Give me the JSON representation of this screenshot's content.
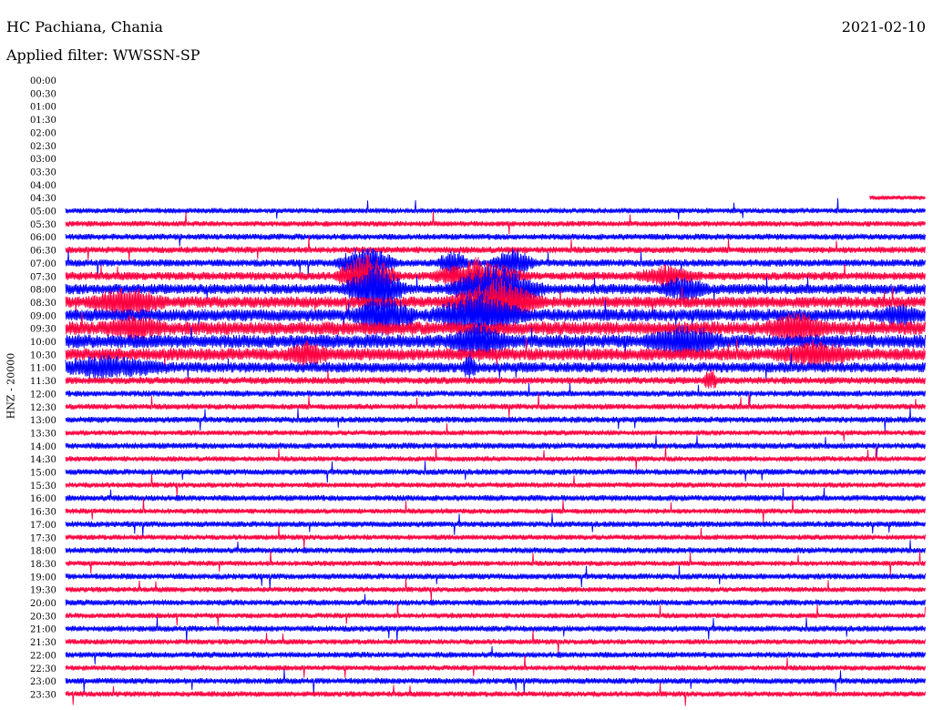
{
  "header": {
    "station": "HC Pachiana, Chania",
    "date": "2021-02-10",
    "filter_label": "Applied filter: WWSSN-SP"
  },
  "chart_data": {
    "type": "line",
    "title": "HC Pachiana, Chania",
    "ylabel": "HNZ - 20000",
    "time_labels": [
      "00:00",
      "00:30",
      "01:00",
      "01:30",
      "02:00",
      "02:30",
      "03:00",
      "03:30",
      "04:00",
      "04:30",
      "05:00",
      "05:30",
      "06:00",
      "06:30",
      "07:00",
      "07:30",
      "08:00",
      "08:30",
      "09:00",
      "09:30",
      "10:00",
      "10:30",
      "11:00",
      "11:30",
      "12:00",
      "12:30",
      "13:00",
      "13:30",
      "14:00",
      "14:30",
      "15:00",
      "15:30",
      "16:00",
      "16:30",
      "17:00",
      "17:30",
      "18:00",
      "18:30",
      "19:00",
      "19:30",
      "20:00",
      "20:30",
      "21:00",
      "21:30",
      "22:00",
      "22:30",
      "23:00",
      "23:30"
    ],
    "colors": {
      "even_rows": "#0000ff",
      "odd_rows": "#ff0040"
    },
    "rows": [
      {
        "start": 0,
        "end": 0,
        "amp": 0
      },
      {
        "start": 0,
        "end": 0,
        "amp": 0
      },
      {
        "start": 0,
        "end": 0,
        "amp": 0
      },
      {
        "start": 0,
        "end": 0,
        "amp": 0
      },
      {
        "start": 0,
        "end": 0,
        "amp": 0
      },
      {
        "start": 0,
        "end": 0,
        "amp": 0
      },
      {
        "start": 0,
        "end": 0,
        "amp": 0
      },
      {
        "start": 0,
        "end": 0,
        "amp": 0
      },
      {
        "start": 0,
        "end": 0,
        "amp": 0
      },
      {
        "start": 0.935,
        "end": 1,
        "amp": 2.2
      },
      {
        "start": 0,
        "end": 1,
        "amp": 2.6
      },
      {
        "start": 0,
        "end": 1,
        "amp": 2.7
      },
      {
        "start": 0,
        "end": 1,
        "amp": 3.0
      },
      {
        "start": 0,
        "end": 1,
        "amp": 3.2
      },
      {
        "start": 0,
        "end": 1,
        "amp": 3.5,
        "events": [
          {
            "pos": 0.35,
            "width": 0.04,
            "amp": 20
          },
          {
            "pos": 0.45,
            "width": 0.02,
            "amp": 15
          },
          {
            "pos": 0.52,
            "width": 0.03,
            "amp": 14
          }
        ]
      },
      {
        "start": 0,
        "end": 1,
        "amp": 4,
        "events": [
          {
            "pos": 0.35,
            "width": 0.04,
            "amp": 24
          },
          {
            "pos": 0.48,
            "width": 0.06,
            "amp": 18
          },
          {
            "pos": 0.7,
            "width": 0.04,
            "amp": 10
          }
        ]
      },
      {
        "start": 0,
        "end": 1,
        "amp": 5,
        "events": [
          {
            "pos": 0.36,
            "width": 0.04,
            "amp": 26
          },
          {
            "pos": 0.5,
            "width": 0.06,
            "amp": 26
          },
          {
            "pos": 0.72,
            "width": 0.03,
            "amp": 12
          }
        ]
      },
      {
        "start": 0,
        "end": 1,
        "amp": 5.5,
        "events": [
          {
            "pos": 0.07,
            "width": 0.05,
            "amp": 14
          },
          {
            "pos": 0.5,
            "width": 0.06,
            "amp": 24
          }
        ]
      },
      {
        "start": 0,
        "end": 1,
        "amp": 6,
        "events": [
          {
            "pos": 0.37,
            "width": 0.04,
            "amp": 22
          },
          {
            "pos": 0.48,
            "width": 0.06,
            "amp": 22
          },
          {
            "pos": 0.97,
            "width": 0.03,
            "amp": 8
          }
        ]
      },
      {
        "start": 0,
        "end": 1,
        "amp": 6.5,
        "events": [
          {
            "pos": 0.08,
            "width": 0.04,
            "amp": 10
          },
          {
            "pos": 0.85,
            "width": 0.04,
            "amp": 14
          }
        ]
      },
      {
        "start": 0,
        "end": 1,
        "amp": 6.5,
        "events": [
          {
            "pos": 0.48,
            "width": 0.04,
            "amp": 16
          },
          {
            "pos": 0.72,
            "width": 0.05,
            "amp": 14
          }
        ]
      },
      {
        "start": 0,
        "end": 1,
        "amp": 6,
        "events": [
          {
            "pos": 0.28,
            "width": 0.03,
            "amp": 10
          },
          {
            "pos": 0.87,
            "width": 0.05,
            "amp": 12
          }
        ]
      },
      {
        "start": 0,
        "end": 1,
        "amp": 5,
        "events": [
          {
            "pos": 0.05,
            "width": 0.08,
            "amp": 10
          },
          {
            "pos": 0.47,
            "width": 0.01,
            "amp": 12
          }
        ]
      },
      {
        "start": 0,
        "end": 1,
        "amp": 3.5,
        "events": [
          {
            "pos": 0.75,
            "width": 0.01,
            "amp": 12
          }
        ]
      },
      {
        "start": 0,
        "end": 1,
        "amp": 3
      },
      {
        "start": 0,
        "end": 1,
        "amp": 2.8
      },
      {
        "start": 0,
        "end": 1,
        "amp": 3
      },
      {
        "start": 0,
        "end": 1,
        "amp": 2.6
      },
      {
        "start": 0,
        "end": 1,
        "amp": 3
      },
      {
        "start": 0,
        "end": 1,
        "amp": 2.6
      },
      {
        "start": 0,
        "end": 1,
        "amp": 2.9
      },
      {
        "start": 0,
        "end": 1,
        "amp": 2.6
      },
      {
        "start": 0,
        "end": 1,
        "amp": 2.9
      },
      {
        "start": 0,
        "end": 1,
        "amp": 2.6
      },
      {
        "start": 0,
        "end": 1,
        "amp": 2.9
      },
      {
        "start": 0,
        "end": 1,
        "amp": 2.6
      },
      {
        "start": 0,
        "end": 1,
        "amp": 2.9
      },
      {
        "start": 0,
        "end": 1,
        "amp": 2.6
      },
      {
        "start": 0,
        "end": 1,
        "amp": 2.9
      },
      {
        "start": 0,
        "end": 1,
        "amp": 2.6
      },
      {
        "start": 0,
        "end": 1,
        "amp": 2.9
      },
      {
        "start": 0,
        "end": 1,
        "amp": 2.6
      },
      {
        "start": 0,
        "end": 1,
        "amp": 2.9
      },
      {
        "start": 0,
        "end": 1,
        "amp": 2.6
      },
      {
        "start": 0,
        "end": 1,
        "amp": 2.9
      },
      {
        "start": 0,
        "end": 1,
        "amp": 2.6
      },
      {
        "start": 0,
        "end": 1,
        "amp": 2.9
      },
      {
        "start": 0,
        "end": 1,
        "amp": 2.7
      }
    ]
  }
}
